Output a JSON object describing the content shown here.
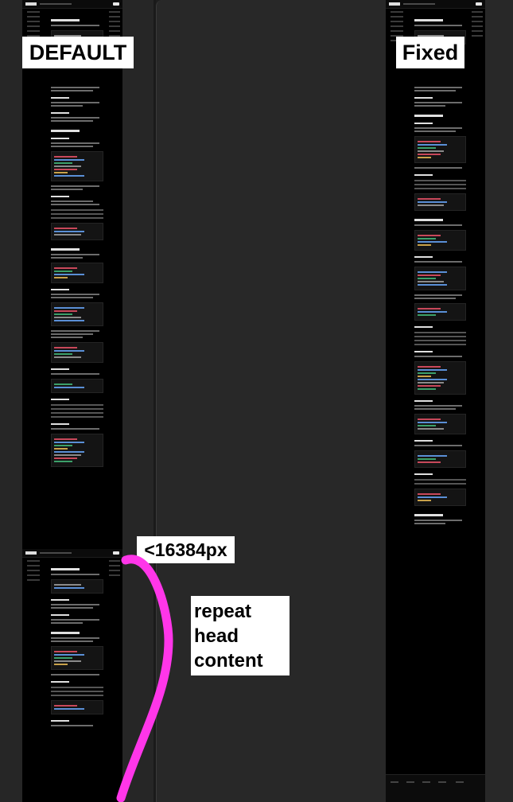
{
  "labels": {
    "default": "DEFAULT",
    "fixed": "Fixed",
    "limit": "<16384px",
    "repeat": "repeat\nhead\ncontent"
  },
  "colors": {
    "annotation_stroke": "#ff36e9",
    "label_background": "#ffffff",
    "label_text": "#000000",
    "screenshot_background": "#000000",
    "window_background": "#262626"
  },
  "icons": {
    "annotation": "magenta-curve-arrow"
  }
}
